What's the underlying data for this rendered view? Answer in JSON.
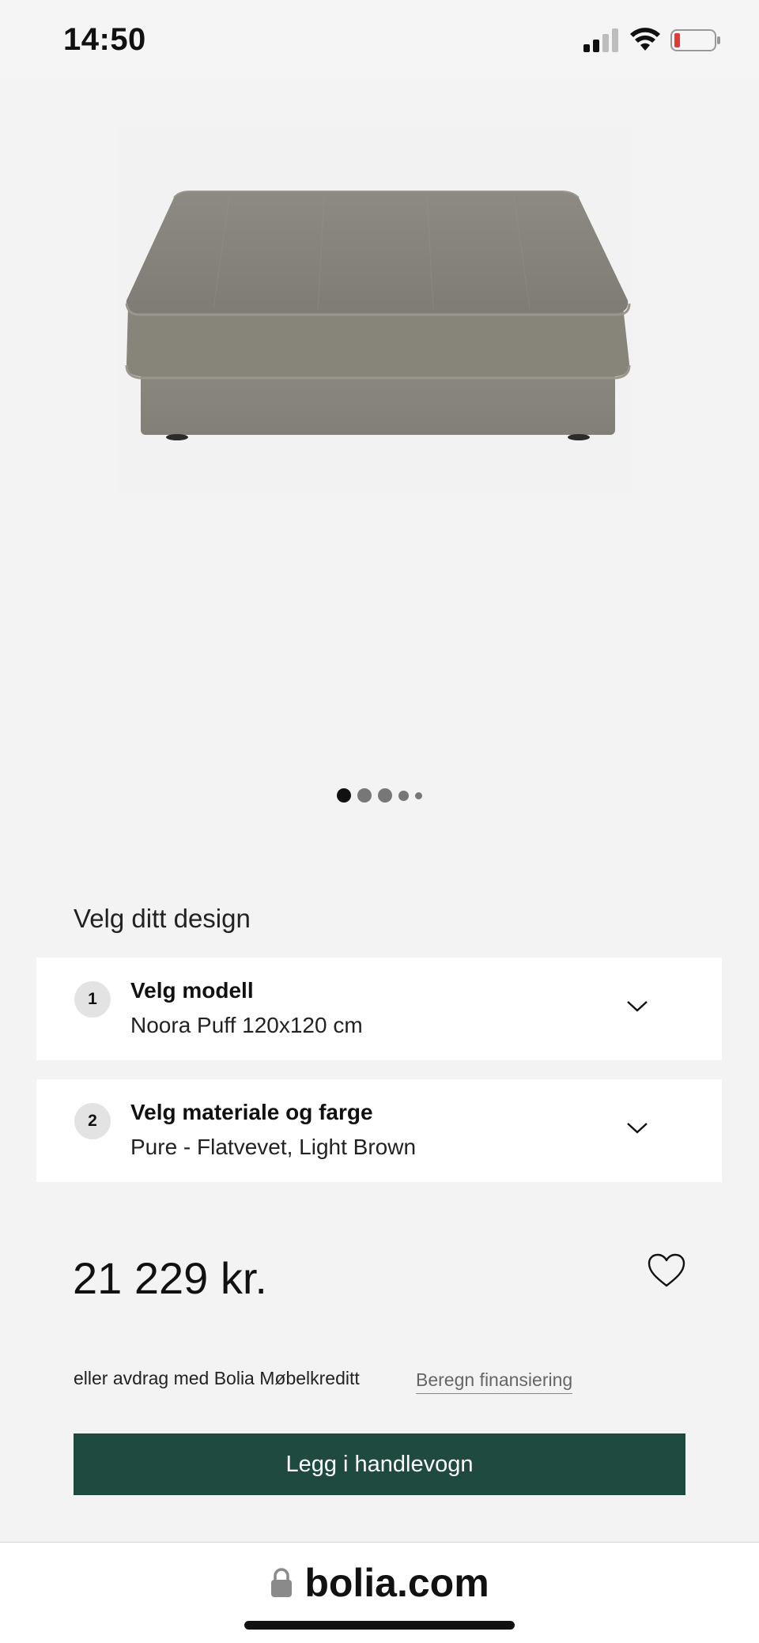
{
  "status_bar": {
    "time": "14:50"
  },
  "product": {
    "image_alt": "Noora Puff",
    "carousel": {
      "total": 5,
      "active": 0
    }
  },
  "design": {
    "heading": "Velg ditt design",
    "options": [
      {
        "step": "1",
        "title": "Velg modell",
        "value": "Noora Puff 120x120 cm"
      },
      {
        "step": "2",
        "title": "Velg materiale og farge",
        "value": "Pure - Flatvevet, Light Brown"
      }
    ]
  },
  "price": {
    "amount": "21 229 kr."
  },
  "finance": {
    "text": "eller avdrag med Bolia Møbelkreditt",
    "link": "Beregn finansiering"
  },
  "cart": {
    "button_label": "Legg i handlevogn",
    "color": "#1f4a3f"
  },
  "browser": {
    "url": "bolia.com"
  }
}
